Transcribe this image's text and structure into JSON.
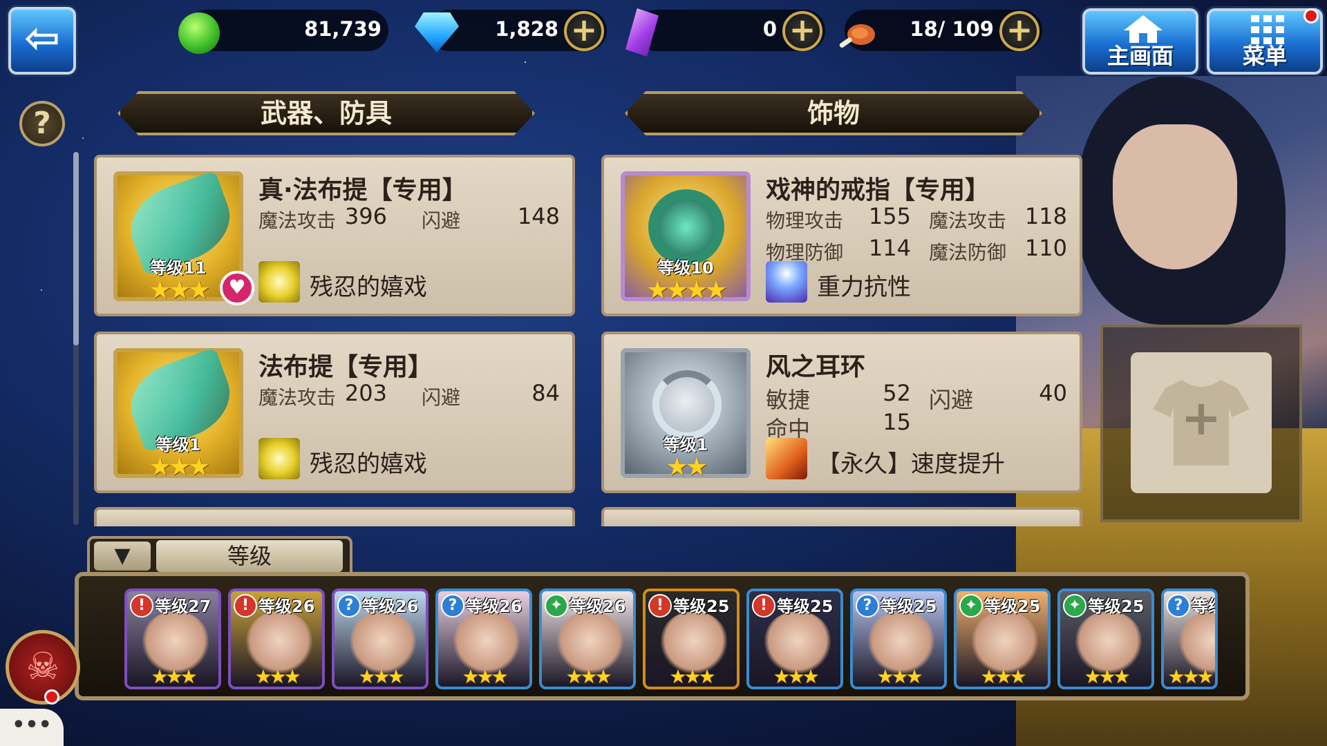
{
  "topbar": {
    "gold": "81,739",
    "gems": "1,828",
    "crystals": "0",
    "stamina": "18/ 109",
    "home_label": "主画面",
    "menu_label": "菜单"
  },
  "sections": {
    "left_title": "武器、防具",
    "right_title": "饰物"
  },
  "cards": [
    {
      "name": "真·法布提【专用】",
      "level": "等级11",
      "stars": "★★★",
      "stats": [
        {
          "label": "魔法攻击",
          "value": "396"
        },
        {
          "label": "闪避",
          "value": "148"
        }
      ],
      "skill": "残忍的嬉戏"
    },
    {
      "name": "戏神的戒指【专用】",
      "level": "等级10",
      "stars": "★★★★",
      "stats": [
        {
          "label": "物理攻击",
          "value": "155"
        },
        {
          "label": "魔法攻击",
          "value": "118"
        },
        {
          "label": "物理防御",
          "value": "114"
        },
        {
          "label": "魔法防御",
          "value": "110"
        }
      ],
      "skill": "重力抗性"
    },
    {
      "name": "法布提【专用】",
      "level": "等级1",
      "stars": "★★★",
      "stats": [
        {
          "label": "魔法攻击",
          "value": "203"
        },
        {
          "label": "闪避",
          "value": "84"
        }
      ],
      "skill": "残忍的嬉戏"
    },
    {
      "name": "风之耳环",
      "level": "等级1",
      "stars": "★★",
      "stats": [
        {
          "label": "敏捷",
          "value": "52"
        },
        {
          "label": "闪避",
          "value": "40"
        },
        {
          "label": "命中",
          "value": "15"
        }
      ],
      "skill": "【永久】速度提升"
    }
  ],
  "sort": {
    "arrow": "▼",
    "label": "等级"
  },
  "heroes": [
    {
      "level": "等级27",
      "stars": "★★★",
      "elem": "!"
    },
    {
      "level": "等级26",
      "stars": "★★★",
      "elem": "!"
    },
    {
      "level": "等级26",
      "stars": "★★★",
      "elem": "?"
    },
    {
      "level": "等级26",
      "stars": "★★★",
      "elem": "?"
    },
    {
      "level": "等级26",
      "stars": "★★★",
      "elem": "✦"
    },
    {
      "level": "等级25",
      "stars": "★★★",
      "elem": "!"
    },
    {
      "level": "等级25",
      "stars": "★★★",
      "elem": "!"
    },
    {
      "level": "等级25",
      "stars": "★★★",
      "elem": "?"
    },
    {
      "level": "等级25",
      "stars": "★★★",
      "elem": "✦"
    },
    {
      "level": "等级25",
      "stars": "★★★",
      "elem": "✦"
    },
    {
      "level": "等级",
      "stars": "★★★",
      "elem": "?"
    }
  ],
  "misc": {
    "help": "?",
    "chat": "•••",
    "slot_plus": "+",
    "back_arrow": "⇦",
    "demon_glyph": "☠"
  },
  "colors": {
    "panel_bg": "#d8cbb6",
    "gold_frame": "#c7a247",
    "accent_blue": "#1a6fd1"
  }
}
